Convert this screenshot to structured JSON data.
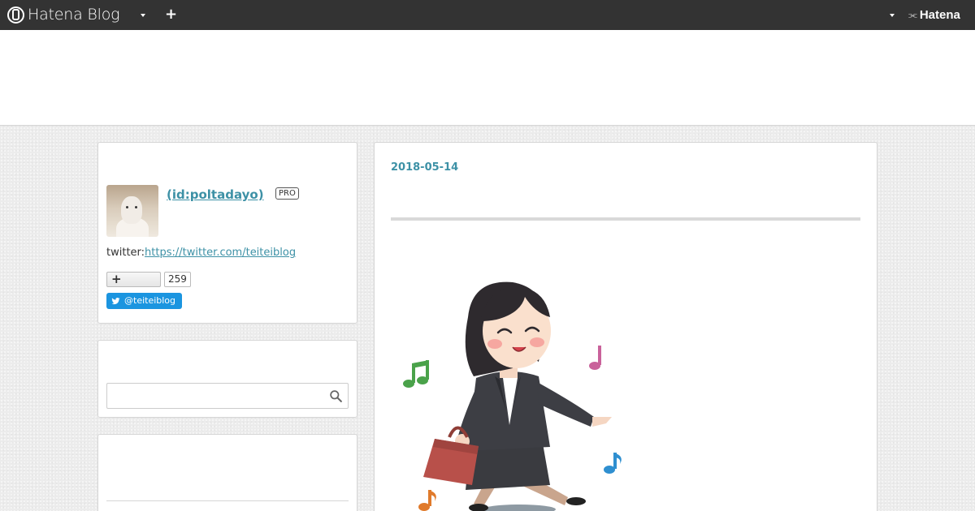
{
  "topbar": {
    "brand": "Hatena Blog",
    "plus": "+",
    "right_brand": "Hatena",
    "right_mark": "⫘"
  },
  "profile": {
    "name": " (id:poltadayo)",
    "badge": "PRO",
    "twitter_label": "twitter:",
    "twitter_url": "https://twitter.com/teiteiblog",
    "follow_plus": "+",
    "follow_count": "259",
    "twitter_handle": "@teiteiblog"
  },
  "search": {
    "placeholder": ""
  },
  "entry": {
    "date": "2018-05-14"
  },
  "colors": {
    "link": "#3d91a6",
    "topbar": "#333333",
    "twitter": "#1b95e0"
  }
}
